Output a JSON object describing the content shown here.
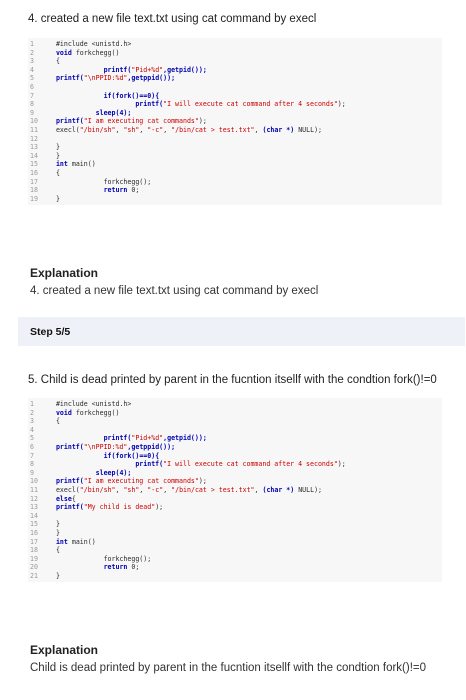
{
  "step4": {
    "heading": "4. created a new file text.txt using cat command by execl",
    "code": [
      {
        "n": "1",
        "segs": [
          {
            "t": "  #include <unistd.h>"
          }
        ]
      },
      {
        "n": "2",
        "segs": [
          {
            "t": "  "
          },
          {
            "t": "void",
            "c": "kw"
          },
          {
            "t": " forkchegg()"
          }
        ]
      },
      {
        "n": "3",
        "segs": [
          {
            "t": "  {"
          }
        ]
      },
      {
        "n": "4",
        "segs": [
          {
            "t": "              printf(",
            "c": "kw"
          },
          {
            "t": "\"Pid+%d\"",
            "c": "str"
          },
          {
            "t": ",getpid());",
            "c": "kw"
          }
        ]
      },
      {
        "n": "5",
        "segs": [
          {
            "t": "  printf(",
            "c": "kw"
          },
          {
            "t": "\"\\nPPID:%d\"",
            "c": "str"
          },
          {
            "t": ",getppid());",
            "c": "kw"
          }
        ]
      },
      {
        "n": "6",
        "segs": [
          {
            "t": ""
          }
        ]
      },
      {
        "n": "7",
        "segs": [
          {
            "t": "              "
          },
          {
            "t": "if",
            "c": "kw"
          },
          {
            "t": "(fork()==0){",
            "c": "kw"
          }
        ]
      },
      {
        "n": "8",
        "segs": [
          {
            "t": "                      printf(",
            "c": "kw"
          },
          {
            "t": "\"I will execute cat command after 4 seconds\"",
            "c": "str"
          },
          {
            "t": ");"
          }
        ]
      },
      {
        "n": "9",
        "segs": [
          {
            "t": "            sleep(4);",
            "c": "kw"
          }
        ]
      },
      {
        "n": "10",
        "segs": [
          {
            "t": "  printf(",
            "c": "kw"
          },
          {
            "t": "\"I am executing cat commands\"",
            "c": "str"
          },
          {
            "t": ");"
          }
        ]
      },
      {
        "n": "11",
        "segs": [
          {
            "t": "  execl("
          },
          {
            "t": "\"/bin/sh\"",
            "c": "str"
          },
          {
            "t": ", "
          },
          {
            "t": "\"sh\"",
            "c": "str"
          },
          {
            "t": ", "
          },
          {
            "t": "\"-c\"",
            "c": "str"
          },
          {
            "t": ", "
          },
          {
            "t": "\"/bin/cat > test.txt\"",
            "c": "str"
          },
          {
            "t": ", "
          },
          {
            "t": "(char *)",
            "c": "kw"
          },
          {
            "t": " NULL);"
          }
        ]
      },
      {
        "n": "12",
        "segs": [
          {
            "t": ""
          }
        ]
      },
      {
        "n": "13",
        "segs": [
          {
            "t": "  }"
          }
        ]
      },
      {
        "n": "14",
        "segs": [
          {
            "t": "  }"
          }
        ]
      },
      {
        "n": "15",
        "segs": [
          {
            "t": "  "
          },
          {
            "t": "int",
            "c": "kw"
          },
          {
            "t": " main()"
          }
        ]
      },
      {
        "n": "16",
        "segs": [
          {
            "t": "  {"
          }
        ]
      },
      {
        "n": "17",
        "segs": [
          {
            "t": "              forkchegg();"
          }
        ]
      },
      {
        "n": "18",
        "segs": [
          {
            "t": "              "
          },
          {
            "t": "return",
            "c": "kw"
          },
          {
            "t": " 0;"
          }
        ]
      },
      {
        "n": "19",
        "segs": [
          {
            "t": "  }"
          }
        ]
      }
    ],
    "explanation_title": "Explanation",
    "explanation_text": "4. created a new file text.txt using cat command by execl"
  },
  "step5": {
    "step_label": "Step 5/5",
    "heading": "5. Child is dead printed by parent in the fucntion itsellf with the condtion fork()!=0",
    "code": [
      {
        "n": "1",
        "segs": [
          {
            "t": "  #include <unistd.h>"
          }
        ]
      },
      {
        "n": "2",
        "segs": [
          {
            "t": "  "
          },
          {
            "t": "void",
            "c": "kw"
          },
          {
            "t": " forkchegg()"
          }
        ]
      },
      {
        "n": "3",
        "segs": [
          {
            "t": "  {"
          }
        ]
      },
      {
        "n": "4",
        "segs": [
          {
            "t": ""
          }
        ]
      },
      {
        "n": "5",
        "segs": [
          {
            "t": "              printf(",
            "c": "kw"
          },
          {
            "t": "\"Pid+%d\"",
            "c": "str"
          },
          {
            "t": ",getpid());",
            "c": "kw"
          }
        ]
      },
      {
        "n": "6",
        "segs": [
          {
            "t": "  printf(",
            "c": "kw"
          },
          {
            "t": "\"\\nPPID:%d\"",
            "c": "str"
          },
          {
            "t": ",getppid());",
            "c": "kw"
          }
        ]
      },
      {
        "n": "7",
        "segs": [
          {
            "t": "              "
          },
          {
            "t": "if",
            "c": "kw"
          },
          {
            "t": "(fork()==0){",
            "c": "kw"
          }
        ]
      },
      {
        "n": "8",
        "segs": [
          {
            "t": "                      printf(",
            "c": "kw"
          },
          {
            "t": "\"I will execute cat command after 4 seconds\"",
            "c": "str"
          },
          {
            "t": ");"
          }
        ]
      },
      {
        "n": "9",
        "segs": [
          {
            "t": "            sleep(4);",
            "c": "kw"
          }
        ]
      },
      {
        "n": "10",
        "segs": [
          {
            "t": "  printf(",
            "c": "kw"
          },
          {
            "t": "\"I am executing cat commands\"",
            "c": "str"
          },
          {
            "t": ");"
          }
        ]
      },
      {
        "n": "11",
        "segs": [
          {
            "t": "  execl("
          },
          {
            "t": "\"/bin/sh\"",
            "c": "str"
          },
          {
            "t": ", "
          },
          {
            "t": "\"sh\"",
            "c": "str"
          },
          {
            "t": ", "
          },
          {
            "t": "\"-c\"",
            "c": "str"
          },
          {
            "t": ", "
          },
          {
            "t": "\"/bin/cat > test.txt\"",
            "c": "str"
          },
          {
            "t": ", "
          },
          {
            "t": "(char *)",
            "c": "kw"
          },
          {
            "t": " NULL);"
          }
        ]
      },
      {
        "n": "12",
        "segs": [
          {
            "t": "  "
          },
          {
            "t": "else",
            "c": "kw"
          },
          {
            "t": "{"
          }
        ]
      },
      {
        "n": "13",
        "segs": [
          {
            "t": "  printf(",
            "c": "kw"
          },
          {
            "t": "\"My child is dead\"",
            "c": "str"
          },
          {
            "t": ");"
          }
        ]
      },
      {
        "n": "14",
        "segs": [
          {
            "t": ""
          }
        ]
      },
      {
        "n": "15",
        "segs": [
          {
            "t": "  }"
          }
        ]
      },
      {
        "n": "16",
        "segs": [
          {
            "t": "  }"
          }
        ]
      },
      {
        "n": "17",
        "segs": [
          {
            "t": "  "
          },
          {
            "t": "int",
            "c": "kw"
          },
          {
            "t": " main()"
          }
        ]
      },
      {
        "n": "18",
        "segs": [
          {
            "t": "  {"
          }
        ]
      },
      {
        "n": "19",
        "segs": [
          {
            "t": "              forkchegg();"
          }
        ]
      },
      {
        "n": "20",
        "segs": [
          {
            "t": "              "
          },
          {
            "t": "return",
            "c": "kw"
          },
          {
            "t": " 0;"
          }
        ]
      },
      {
        "n": "21",
        "segs": [
          {
            "t": "  }"
          }
        ]
      }
    ],
    "explanation_title": "Explanation",
    "explanation_text": "Child is dead printed by parent in the fucntion itsellf with the condtion fork()!=0"
  }
}
